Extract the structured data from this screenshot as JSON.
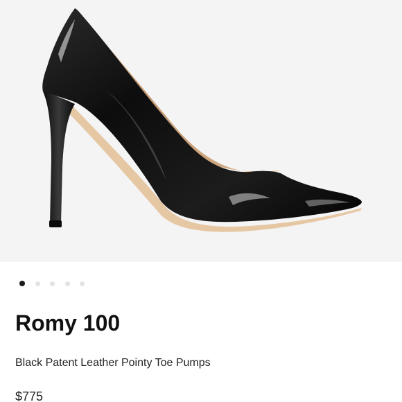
{
  "product": {
    "image_subject": "black-patent-pump",
    "carousel": {
      "total": 5,
      "active_index": 0
    },
    "name": "Romy 100",
    "description": "Black Patent Leather Pointy Toe Pumps",
    "price": "$775"
  },
  "colors": {
    "gallery_background": "#f4f4f4",
    "dot_active": "#1a1a1a",
    "dot_inactive": "#e3e3e3",
    "text_primary": "#111111"
  }
}
